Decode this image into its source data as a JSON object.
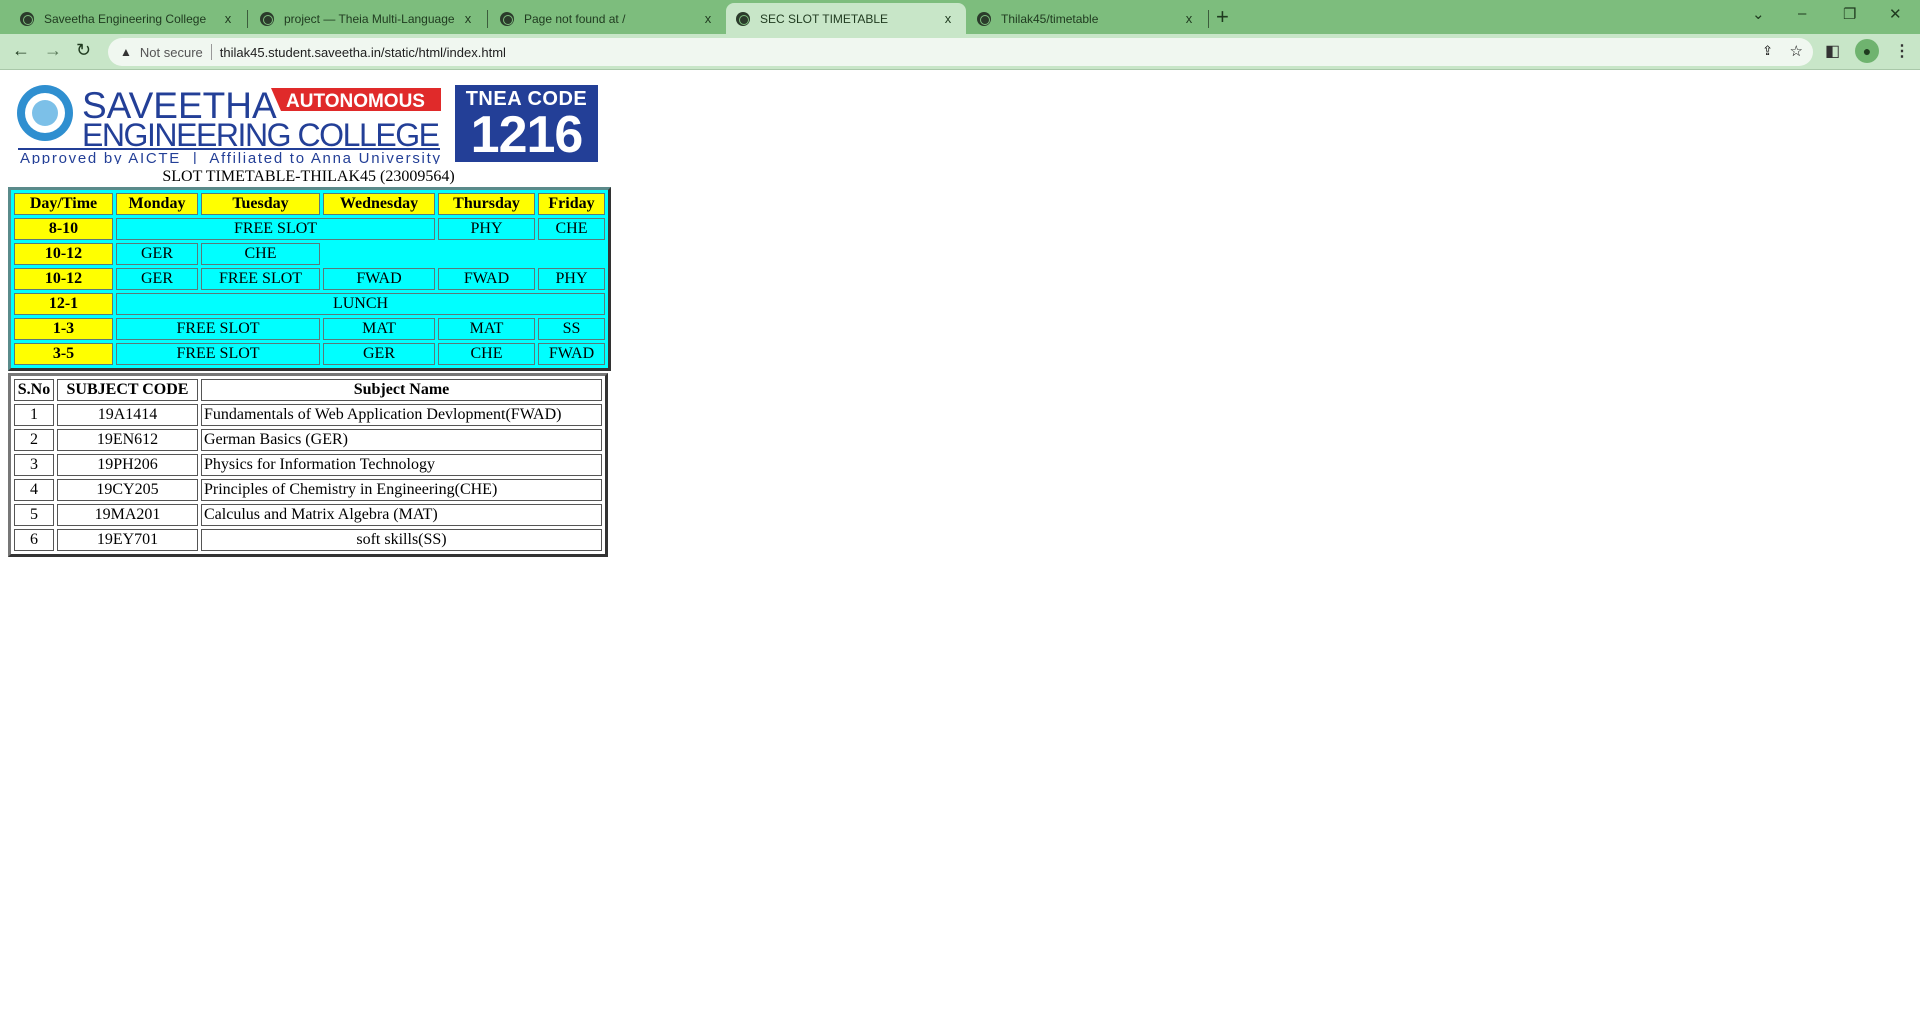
{
  "browser": {
    "tabs": [
      {
        "title": "Saveetha Engineering College",
        "icon": "globe-icon",
        "active": false
      },
      {
        "title": "project — Theia Multi-Language",
        "icon": "globe-icon",
        "active": false
      },
      {
        "title": "Page not found at /",
        "icon": "globe-icon",
        "active": false
      },
      {
        "title": "SEC SLOT TIMETABLE",
        "icon": "globe-icon",
        "active": true
      },
      {
        "title": "Thilak45/timetable",
        "icon": "github-icon",
        "active": false
      }
    ],
    "close": "x",
    "new_tab": "+",
    "security": "Not secure",
    "url": "thilak45.student.saveetha.in/static/html/index.html",
    "colors": {
      "tabbar": "#7dbd7d",
      "toolbar": "#c8e6c8"
    }
  },
  "logo": {
    "name": "SAVEETHA",
    "badge": "AUTONOMOUS",
    "line2": "ENGINEERING COLLEGE",
    "tagline": "Approved by AICTE  |  Affiliated to Anna University",
    "tnea_label": "TNEA CODE",
    "tnea_code": "1216"
  },
  "caption": "SLOT TIMETABLE-THILAK45 (23009564)",
  "timetable": {
    "headers": [
      "Day/Time",
      "Monday",
      "Tuesday",
      "Wednesday",
      "Thursday",
      "Friday"
    ],
    "rows": [
      {
        "time": "8-10",
        "cells": [
          {
            "text": "FREE SLOT",
            "span": 3
          },
          {
            "text": "PHY",
            "span": 1
          },
          {
            "text": "CHE",
            "span": 1
          }
        ]
      },
      {
        "time": "10-12",
        "cells": [
          {
            "text": "GER",
            "span": 1
          },
          {
            "text": "CHE",
            "span": 1
          }
        ]
      },
      {
        "time": "10-12",
        "cells": [
          {
            "text": "GER",
            "span": 1
          },
          {
            "text": "FREE SLOT",
            "span": 1
          },
          {
            "text": "FWAD",
            "span": 1
          },
          {
            "text": "FWAD",
            "span": 1
          },
          {
            "text": "PHY",
            "span": 1
          }
        ]
      },
      {
        "time": "12-1",
        "cells": [
          {
            "text": "LUNCH",
            "span": 5
          }
        ]
      },
      {
        "time": "1-3",
        "cells": [
          {
            "text": "FREE SLOT",
            "span": 2
          },
          {
            "text": "MAT",
            "span": 1
          },
          {
            "text": "MAT",
            "span": 1
          },
          {
            "text": "SS",
            "span": 1
          }
        ]
      },
      {
        "time": "3-5",
        "cells": [
          {
            "text": "FREE SLOT",
            "span": 2
          },
          {
            "text": "GER",
            "span": 1
          },
          {
            "text": "CHE",
            "span": 1
          },
          {
            "text": "FWAD",
            "span": 1
          }
        ]
      }
    ],
    "colors": {
      "header": "#ffff00",
      "cell": "#00ffff"
    }
  },
  "subjects": {
    "headers": [
      "S.No",
      "SUBJECT CODE",
      "Subject Name"
    ],
    "rows": [
      [
        "1",
        "19A1414",
        "Fundamentals of Web Application Devlopment(FWAD)"
      ],
      [
        "2",
        "19EN612",
        "German Basics (GER)"
      ],
      [
        "3",
        "19PH206",
        "Physics for Information Technology"
      ],
      [
        "4",
        "19CY205",
        "Principles of Chemistry in Engineering(CHE)"
      ],
      [
        "5",
        "19MA201",
        "Calculus and Matrix Algebra (MAT)"
      ],
      [
        "6",
        "19EY701",
        "soft skills(SS)"
      ]
    ]
  }
}
